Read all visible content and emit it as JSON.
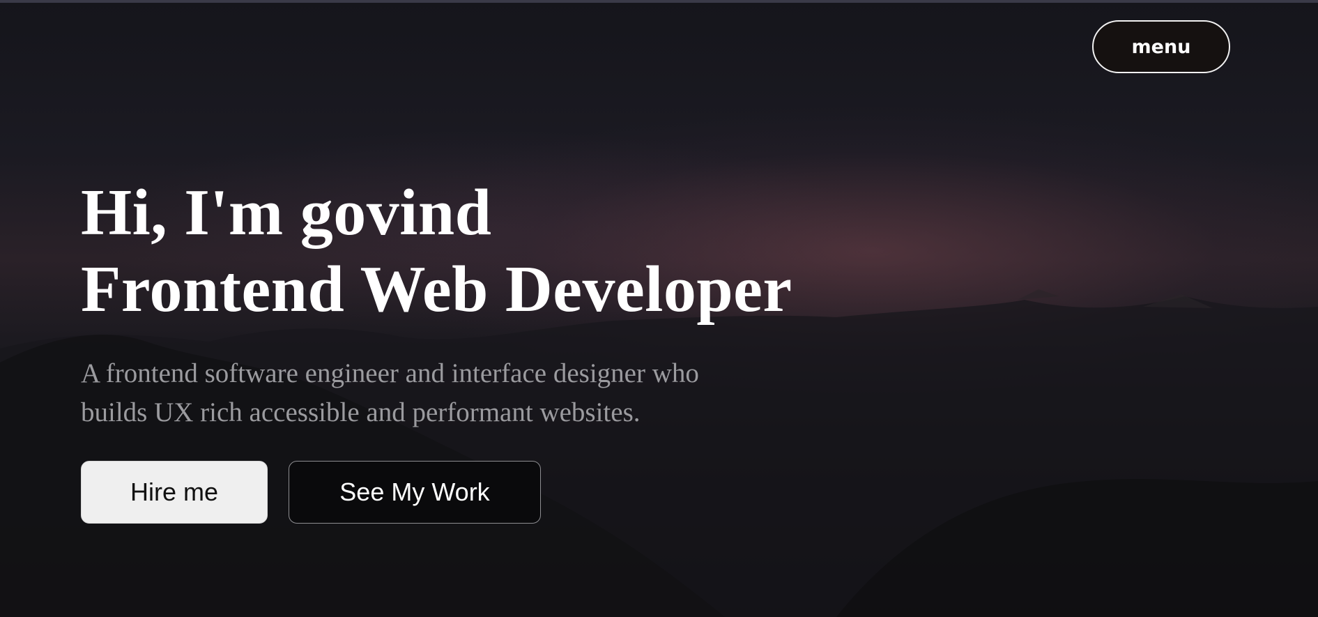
{
  "header": {
    "menu_label": "menu"
  },
  "hero": {
    "headline_line1": "Hi, I'm govind",
    "headline_line2": "Frontend Web Developer",
    "subtitle_line1": "A frontend software engineer and interface designer who",
    "subtitle_line2": "builds UX rich accessible and performant websites.",
    "primary_button_label": "Hire me",
    "secondary_button_label": "See My Work"
  },
  "colors": {
    "background": "#0b0b0e",
    "headline_text": "#ffffff",
    "subtitle_text": "#9b9b9f",
    "primary_button_bg": "#efefef",
    "secondary_button_border": "#8e8e92"
  }
}
